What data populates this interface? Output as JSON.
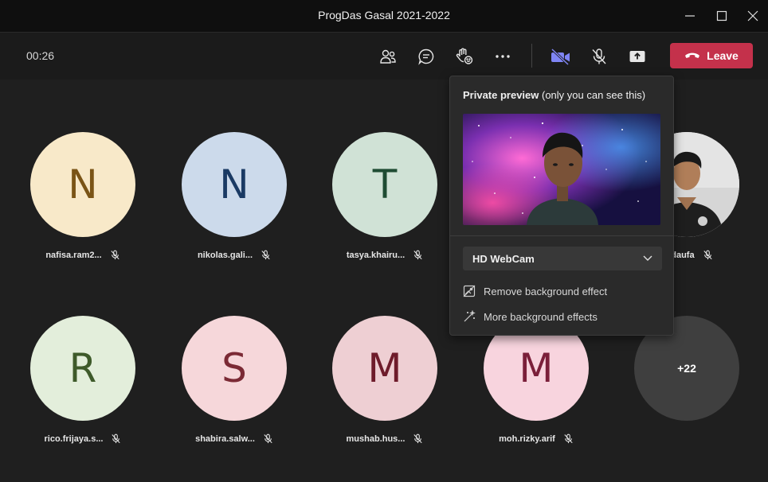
{
  "window": {
    "title": "ProgDas Gasal 2021-2022"
  },
  "toolbar": {
    "timer": "00:26",
    "leave_label": "Leave",
    "icons": [
      "people-icon",
      "chat-icon",
      "raise-hand-icon",
      "more-icon",
      "camera-off-icon",
      "mic-off-icon",
      "share-icon"
    ]
  },
  "preview": {
    "title": "Private preview",
    "subtitle": " (only you can see this)",
    "camera": "HD WebCam",
    "menu": [
      "Remove background effect",
      "More background effects"
    ]
  },
  "participants": [
    {
      "initial": "N",
      "name": "nafisa.ram2...",
      "bg": "#f8e9c9",
      "fg": "#7a5416",
      "muted": true
    },
    {
      "initial": "N",
      "name": "nikolas.gali...",
      "bg": "#ccdaeb",
      "fg": "#1a3a64",
      "muted": true
    },
    {
      "initial": "T",
      "name": "tasya.khairu...",
      "bg": "#d0e2d6",
      "fg": "#1f4c33",
      "muted": true
    },
    {
      "initial": "",
      "name": "nadaufa",
      "bg": "#cccccc",
      "fg": "#000000",
      "muted": true,
      "photo": true
    },
    {
      "initial": "R",
      "name": "rico.frijaya.s...",
      "bg": "#e3eedb",
      "fg": "#3e5a2a",
      "muted": true
    },
    {
      "initial": "S",
      "name": "shabira.salw...",
      "bg": "#f6d7da",
      "fg": "#7b2a35",
      "muted": true
    },
    {
      "initial": "M",
      "name": "mushab.hus...",
      "bg": "#eecfd3",
      "fg": "#6e1c2b",
      "muted": true
    },
    {
      "initial": "M",
      "name": "moh.rizky.arif",
      "bg": "#f8d4de",
      "fg": "#7b1f3a",
      "muted": true
    },
    {
      "initial": "+22",
      "name": "",
      "bg": "#3f3f3f",
      "fg": "#ffffff",
      "muted": false
    }
  ]
}
